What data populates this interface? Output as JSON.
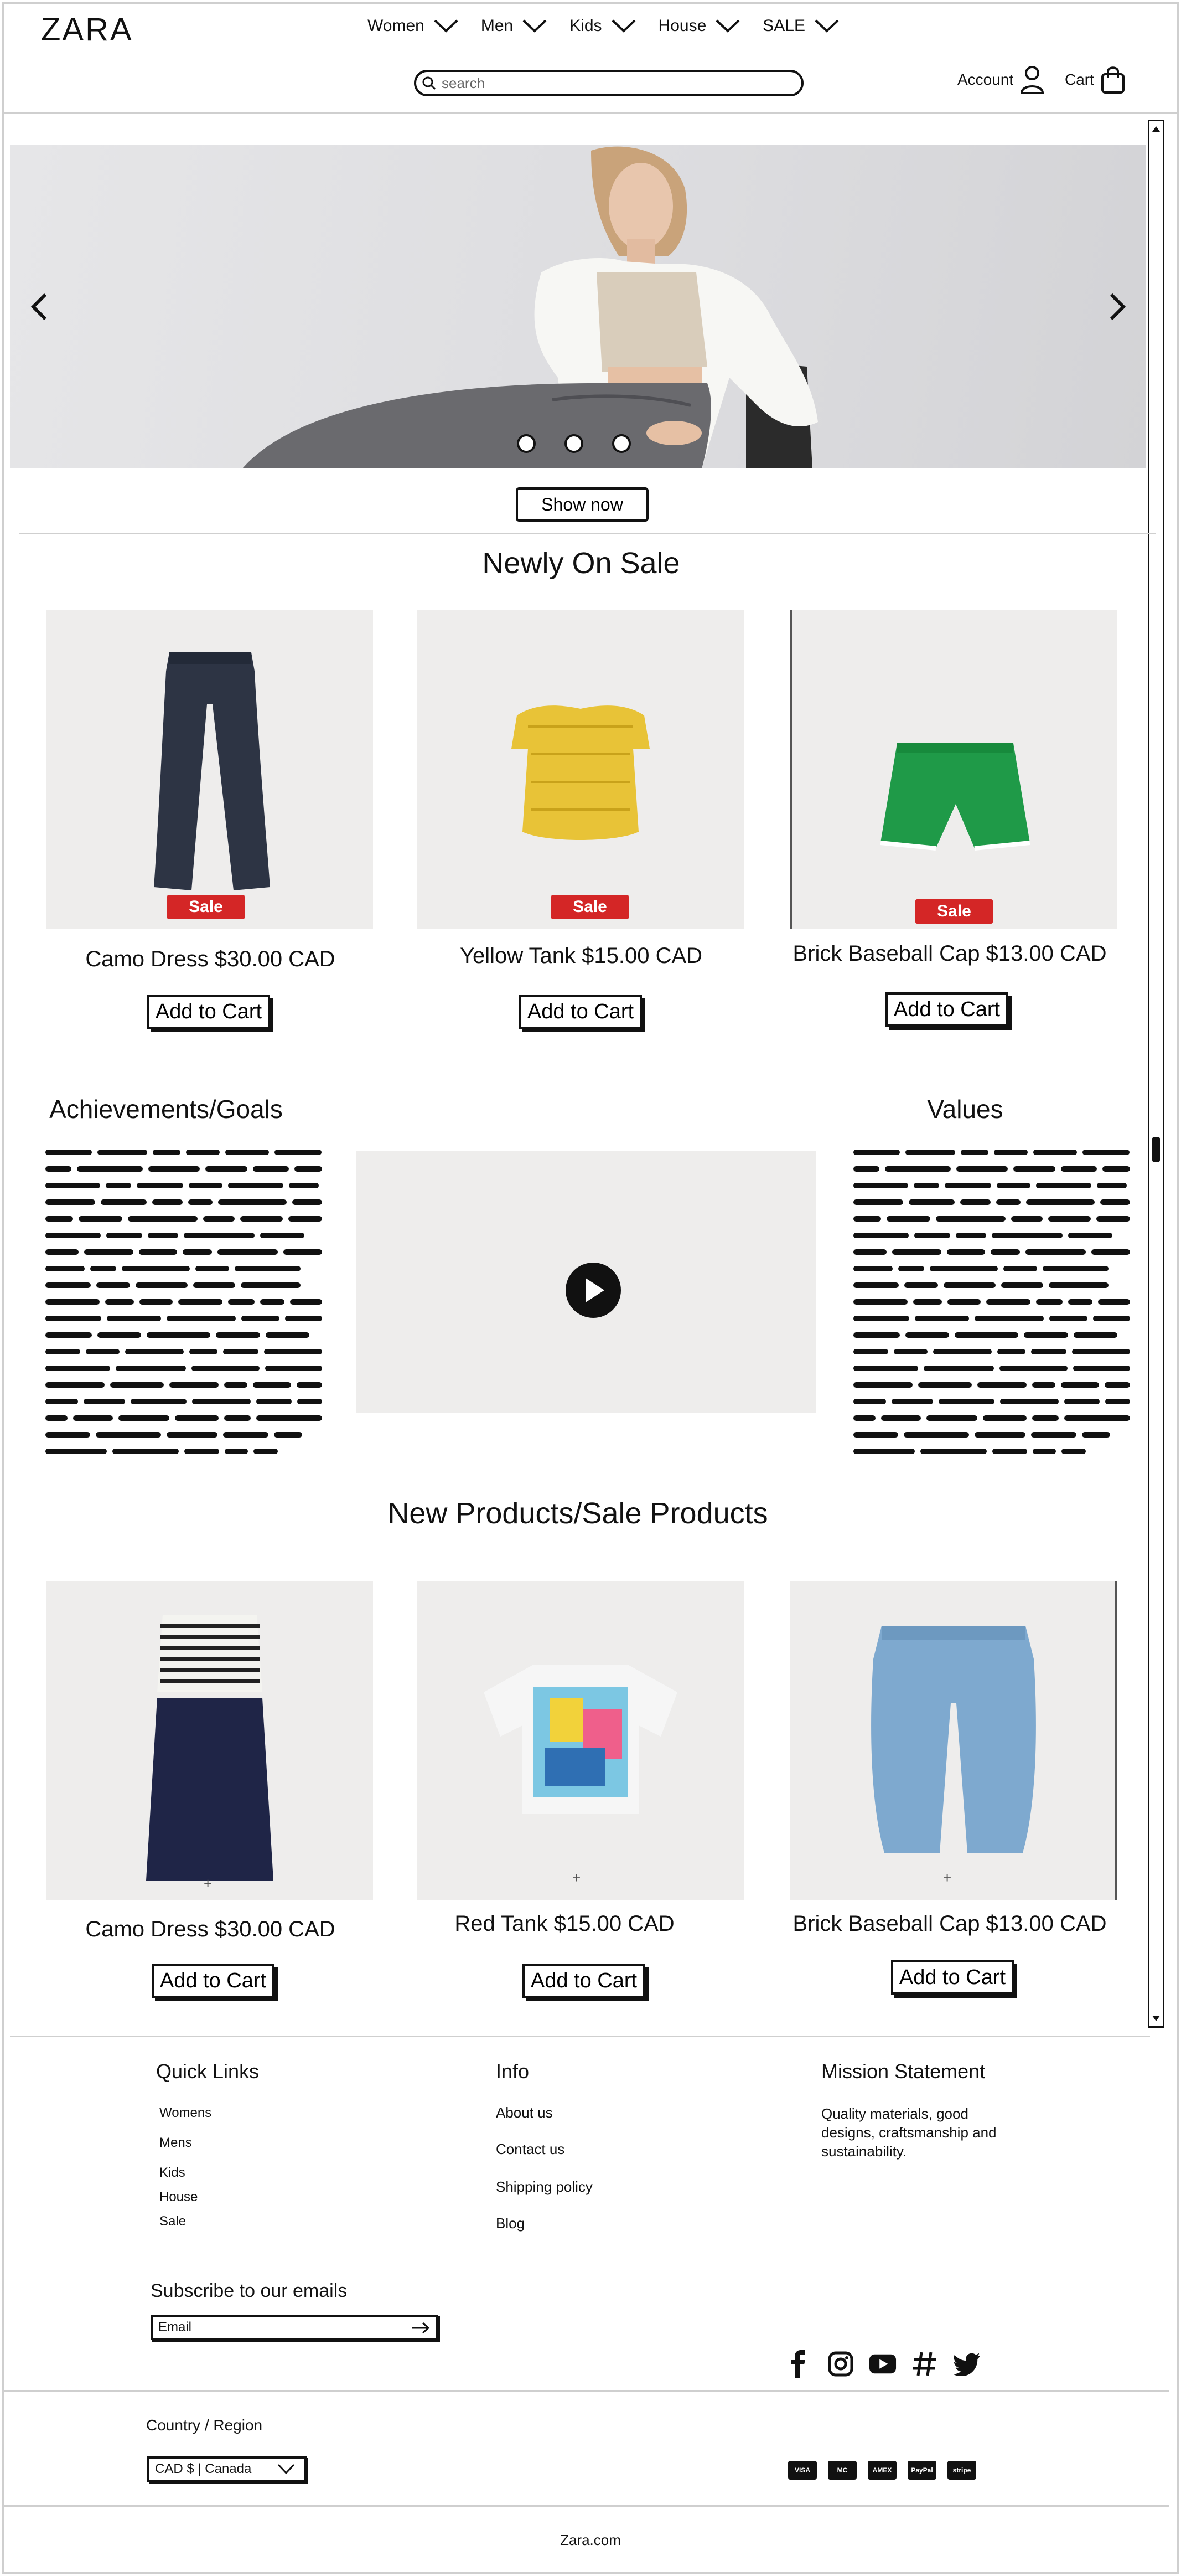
{
  "header": {
    "logo": "ZARA",
    "nav": [
      {
        "label": "Women"
      },
      {
        "label": "Men"
      },
      {
        "label": "Kids"
      },
      {
        "label": "House"
      },
      {
        "label": "SALE"
      }
    ],
    "search_placeholder": "search",
    "account_label": "Account",
    "cart_label": "Cart"
  },
  "hero": {
    "slide_count": 3,
    "cta_label": "Show now"
  },
  "newly_on_sale": {
    "title": "Newly On Sale",
    "badge": "Sale",
    "products": [
      {
        "name": "Camo Dress $30.00 CAD",
        "image": "dark-jeans"
      },
      {
        "name": "Yellow Tank $15.00 CAD",
        "image": "yellow-crochet-top"
      },
      {
        "name": "Brick Baseball Cap $13.00 CAD",
        "image": "green-shorts"
      }
    ],
    "add_label": "Add to Cart"
  },
  "about": {
    "achievements_title": "Achievements/Goals",
    "values_title": "Values"
  },
  "new_products": {
    "title": "New Products/Sale Products",
    "products": [
      {
        "name": "Camo Dress $30.00 CAD",
        "image": "striped-top-navy-skirt"
      },
      {
        "name": "Red Tank $15.00 CAD",
        "image": "graphic-tee"
      },
      {
        "name": "Brick Baseball Cap $13.00 CAD",
        "image": "light-jeans"
      }
    ],
    "add_label": "Add to Cart",
    "plus": "+"
  },
  "footer": {
    "quick_links_title": "Quick Links",
    "quick_links": [
      "Womens",
      "Mens",
      "Kids",
      "House",
      "Sale"
    ],
    "info_title": "Info",
    "info_links": [
      "About us",
      "Contact us",
      "Shipping policy",
      "Blog"
    ],
    "mission_title": "Mission Statement",
    "mission_text": "Quality materials, good designs, craftsmanship and sustainability.",
    "subscribe_title": "Subscribe to our emails",
    "email_placeholder": "Email",
    "social": [
      "facebook-icon",
      "instagram-icon",
      "youtube-icon",
      "hashtag-icon",
      "twitter-icon"
    ],
    "country_label": "Country / Region",
    "country_value": "CAD $ | Canada",
    "payments": [
      "VISA",
      "MC",
      "AMEX",
      "PayPal",
      "stripe"
    ],
    "site": "Zara.com"
  }
}
